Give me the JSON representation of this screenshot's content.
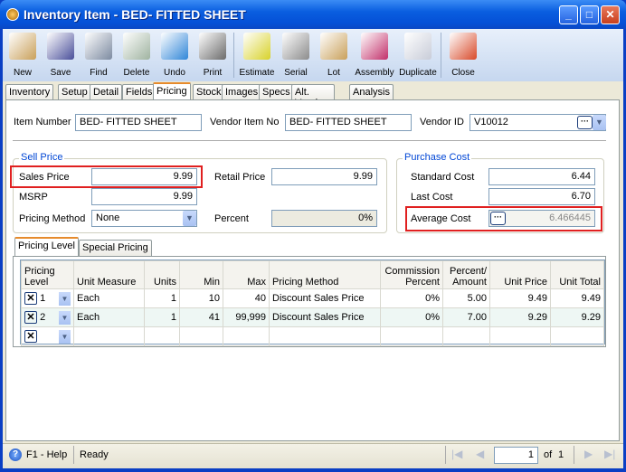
{
  "window": {
    "title": "Inventory Item - BED- FITTED SHEET"
  },
  "toolbar": [
    {
      "label": "New",
      "icon": "new-item-icon",
      "color": "#c9a05a"
    },
    {
      "label": "Save",
      "icon": "floppy-disk-icon",
      "color": "#4a4f9a"
    },
    {
      "label": "Find",
      "icon": "binoculars-icon",
      "color": "#7c8aa0"
    },
    {
      "label": "Delete",
      "icon": "recycle-bin-icon",
      "color": "#9fb3a0"
    },
    {
      "label": "Undo",
      "icon": "undo-arrow-icon",
      "color": "#2f86d8"
    },
    {
      "label": "Print",
      "icon": "printer-icon",
      "color": "#6b6b6b"
    },
    {
      "label": "Estimate",
      "icon": "estimate-icon",
      "color": "#d8d22a"
    },
    {
      "label": "Serial",
      "icon": "barcode-icon",
      "color": "#8c8c8c"
    },
    {
      "label": "Lot",
      "icon": "lot-box-icon",
      "color": "#c9a05a"
    },
    {
      "label": "Assembly",
      "icon": "assembly-icon",
      "color": "#c2306a"
    },
    {
      "label": "Duplicate",
      "icon": "duplicate-icon",
      "color": "#c8ccd8"
    },
    {
      "label": "Close",
      "icon": "close-form-icon",
      "color": "#d84a2a"
    }
  ],
  "tabs": [
    "Inventory",
    "Setup",
    "Detail",
    "Fields",
    "Pricing",
    "Stock",
    "Images",
    "Specs",
    "Alt. Vendors",
    "Analysis"
  ],
  "active_tab": "Pricing",
  "header": {
    "item_number_label": "Item Number",
    "item_number": "BED- FITTED SHEET",
    "vendor_item_no_label": "Vendor Item No",
    "vendor_item_no": "BED- FITTED SHEET",
    "vendor_id_label": "Vendor ID",
    "vendor_id": "V10012"
  },
  "sell_price": {
    "title": "Sell Price",
    "sales_price_label": "Sales Price",
    "sales_price": "9.99",
    "retail_price_label": "Retail Price",
    "retail_price": "9.99",
    "msrp_label": "MSRP",
    "msrp": "9.99",
    "pricing_method_label": "Pricing Method",
    "pricing_method": "None",
    "percent_label": "Percent",
    "percent": "0%"
  },
  "purchase_cost": {
    "title": "Purchase Cost",
    "standard_cost_label": "Standard Cost",
    "standard_cost": "6.44",
    "last_cost_label": "Last Cost",
    "last_cost": "6.70",
    "average_cost_label": "Average Cost",
    "average_cost": "6.466445"
  },
  "subtabs": [
    "Pricing Level",
    "Special Pricing"
  ],
  "grid": {
    "headers": [
      "Pricing Level",
      "Unit Measure",
      "Units",
      "Min",
      "Max",
      "Pricing Method",
      "Commission Percent",
      "Percent/ Amount",
      "Unit Price",
      "Unit Total"
    ],
    "rows": [
      [
        "1",
        "Each",
        "1",
        "10",
        "40",
        "Discount Sales Price",
        "0%",
        "5.00",
        "9.49",
        "9.49"
      ],
      [
        "2",
        "Each",
        "1",
        "41",
        "99,999",
        "Discount Sales Price",
        "0%",
        "7.00",
        "9.29",
        "9.29"
      ]
    ]
  },
  "status": {
    "help": "F1 - Help",
    "state": "Ready",
    "page": "1",
    "of_label": "of",
    "total_pages": "1"
  }
}
